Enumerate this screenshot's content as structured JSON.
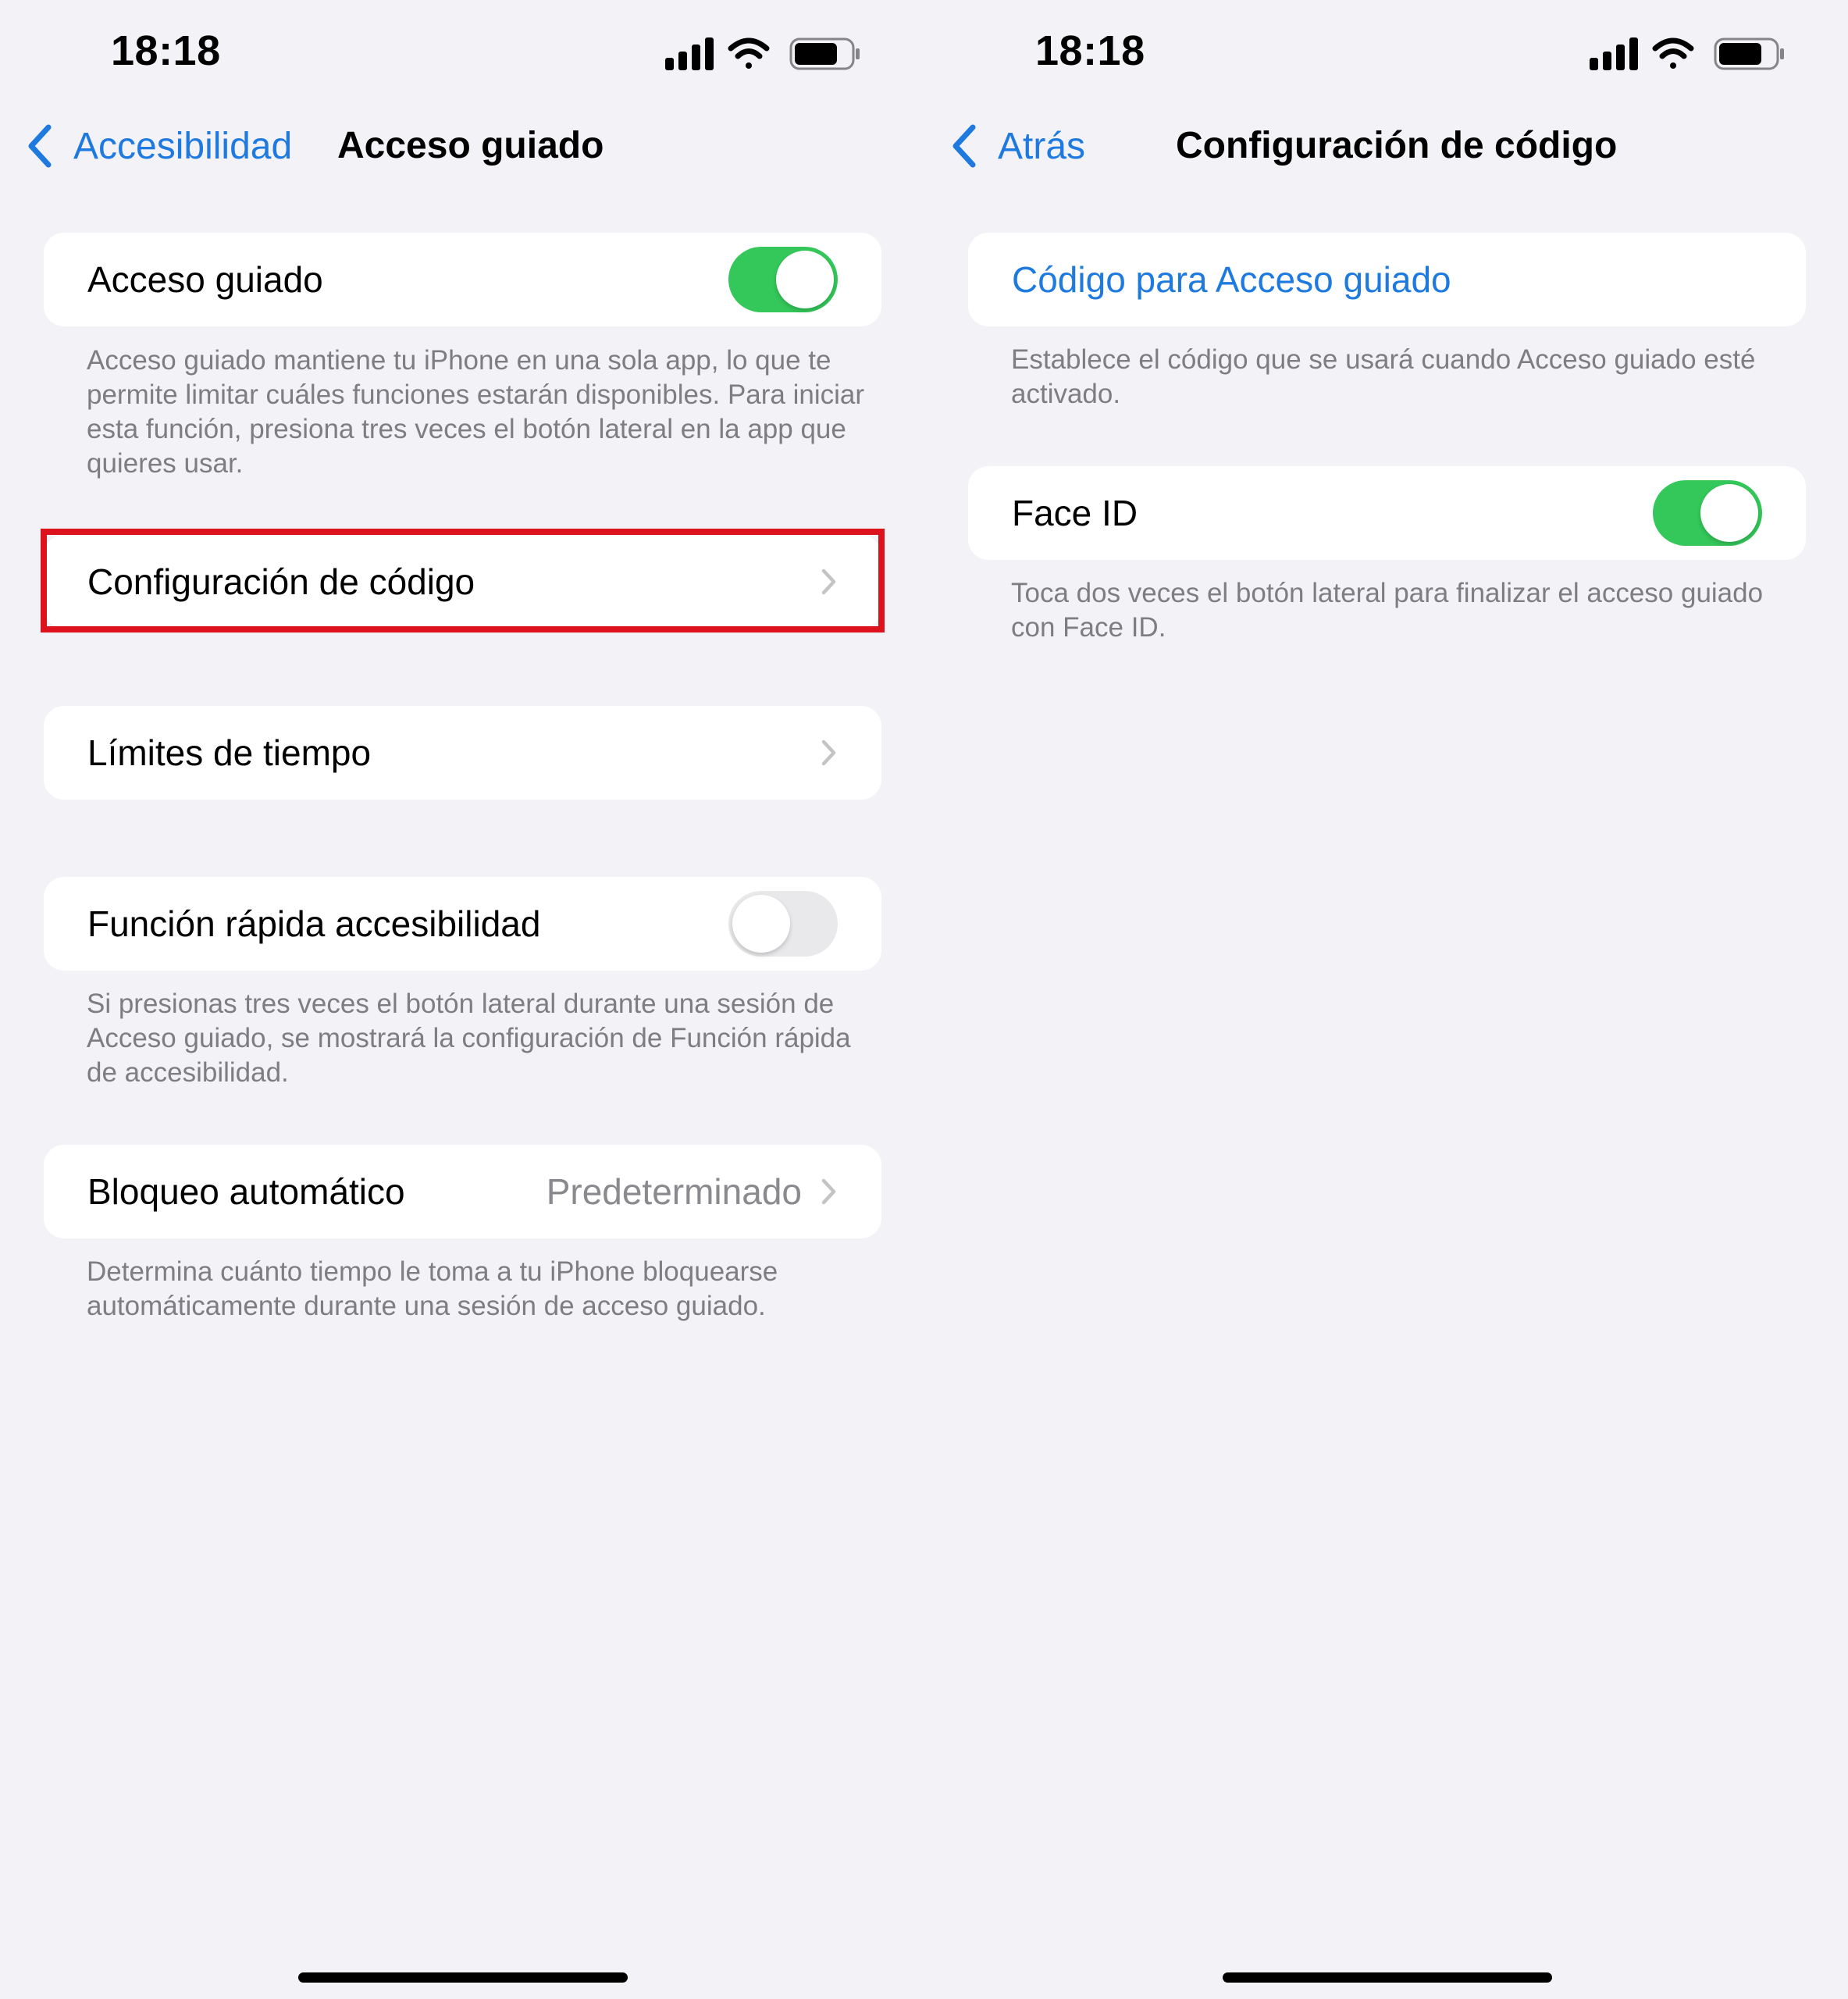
{
  "colors": {
    "background": "#f2f2f7",
    "card": "#ffffff",
    "accent_link": "#1f7ae0",
    "toggle_on": "#34c759",
    "toggle_off": "#e9e9eb",
    "secondary_text": "#7d7d82",
    "highlight_border": "#dc121c"
  },
  "left_screen": {
    "status_bar": {
      "time": "18:18",
      "icons": [
        "cellular-signal-icon",
        "wifi-icon",
        "battery-icon"
      ]
    },
    "nav": {
      "back_label": "Accesibilidad",
      "title": "Acceso guiado"
    },
    "sections": {
      "acceso_guiado": {
        "label": "Acceso guiado",
        "toggle_on": true
      },
      "acceso_guiado_footer": "Acceso guiado mantiene tu iPhone en una sola app, lo que te permite limitar cuáles funciones estarán disponibles. Para iniciar esta función, presiona tres veces el botón lateral en la app que quieres usar.",
      "configuracion_codigo": {
        "label": "Configuración de código",
        "highlighted": true
      },
      "limites_tiempo": {
        "label": "Límites de tiempo"
      },
      "funcion_rapida": {
        "label": "Función rápida accesibilidad",
        "toggle_on": false
      },
      "funcion_rapida_footer": "Si presionas tres veces el botón lateral durante una sesión de Acceso guiado, se mostrará la configuración de Función rápida de accesibilidad.",
      "bloqueo_automatico": {
        "label": "Bloqueo automático",
        "value": "Predeterminado"
      },
      "bloqueo_automatico_footer": "Determina cuánto tiempo le toma a tu iPhone bloquearse automáticamente durante una sesión de acceso guiado."
    }
  },
  "right_screen": {
    "status_bar": {
      "time": "18:18",
      "icons": [
        "cellular-signal-icon",
        "wifi-icon",
        "battery-icon"
      ]
    },
    "nav": {
      "back_label": "Atrás",
      "title": "Configuración de código"
    },
    "sections": {
      "codigo_acceso": {
        "label": "Código para Acceso guiado"
      },
      "codigo_acceso_footer": "Establece el código que se usará cuando Acceso guiado esté activado.",
      "face_id": {
        "label": "Face ID",
        "toggle_on": true
      },
      "face_id_footer": "Toca dos veces el botón lateral para finalizar el acceso guiado con Face ID."
    }
  }
}
